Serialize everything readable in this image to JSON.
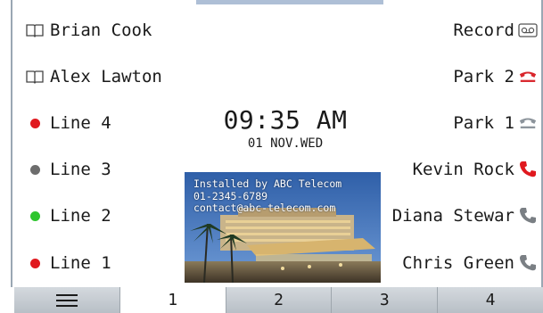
{
  "left_keys": [
    {
      "label": "Brian Cook",
      "icon": "book-icon"
    },
    {
      "label": "Alex Lawton",
      "icon": "book-icon"
    },
    {
      "label": "Line 4",
      "icon": "status-dot-red",
      "color": "#e0191f"
    },
    {
      "label": "Line 3",
      "icon": "status-dot-gray",
      "color": "#6d6d6d"
    },
    {
      "label": "Line 2",
      "icon": "status-dot-green",
      "color": "#2ec52e"
    },
    {
      "label": "Line 1",
      "icon": "status-dot-red",
      "color": "#e0191f"
    }
  ],
  "right_keys": [
    {
      "label": "Record",
      "icon": "voicemail-record-icon"
    },
    {
      "label": "Park 2",
      "icon": "park-handset-red-icon",
      "color": "#d9262c"
    },
    {
      "label": "Park 1",
      "icon": "park-handset-gray-icon",
      "color": "#8c949b"
    },
    {
      "label": "Kevin Rock",
      "icon": "handset-red-icon",
      "color": "#e0191f"
    },
    {
      "label": "Diana Stewar",
      "icon": "handset-gray-icon",
      "color": "#7a7f84"
    },
    {
      "label": "Chris Green",
      "icon": "handset-gray-icon",
      "color": "#7a7f84"
    }
  ],
  "clock": {
    "time": "09:35 AM",
    "date": "01 NOV.WED"
  },
  "ad": {
    "line1": "Installed by ABC Telecom",
    "line2": "01-2345-6789",
    "line3": "contact@abc-telecom.com"
  },
  "tabs": [
    {
      "label": "",
      "icon": "menu-icon"
    },
    {
      "label": "1",
      "active": true
    },
    {
      "label": "2"
    },
    {
      "label": "3"
    },
    {
      "label": "4"
    }
  ]
}
